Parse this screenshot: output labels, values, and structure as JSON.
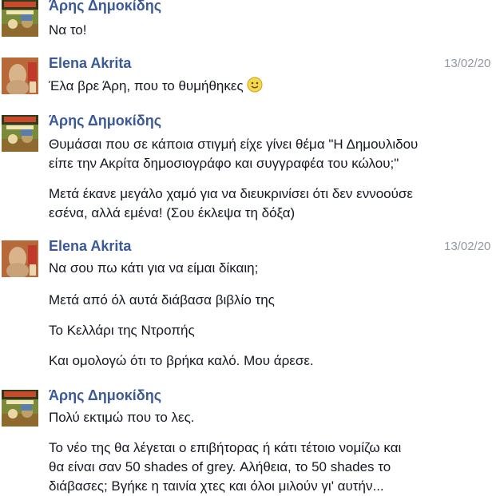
{
  "conversation": {
    "groups": [
      {
        "sender": "Άρης Δημοκίδης",
        "date": "",
        "messages": [
          "Να το!"
        ]
      },
      {
        "sender": "Elena Akrita",
        "date": "13/02/20",
        "messages": [
          "Έλα βρε Άρη, που το θυμήθηκες"
        ]
      },
      {
        "sender": "Άρης Δημοκίδης",
        "date": "",
        "messages": [
          "Θυμάσαι που σε κάποια στιγμή είχε γίνει θέμα \"Η Δημουλιδου",
          "είπε την Ακρίτα δημοσιογράφο και συγγραφέα του κώλου;\"",
          "Μετά έκανε μεγάλο χαμό για να διευκρινίσει ότι δεν εννοούσε",
          "εσένα, αλλά εμένα! (Σου έκλεψα τη δόξα)"
        ]
      },
      {
        "sender": "Elena Akrita",
        "date": "13/02/20",
        "messages": [
          "Να σου πω κάτι για να είμαι δίκαιη;",
          "Μετά από όλ αυτά διάβασα βιβλίο της",
          "Το Κελλάρι της Ντροπής",
          "Και ομολογώ ότι το βρήκα καλό. Μου άρεσε."
        ]
      },
      {
        "sender": "Άρης Δημοκίδης",
        "date": "",
        "messages": [
          "Πολύ εκτιμώ που το λες.",
          "Το νέο της θα λέγεται ο επιβήτορας ή κάτι τέτοιο νομίζω και",
          "θα είναι σαν 50 shades of grey. Αλήθεια, το 50 shades το",
          "διάβασες; Βγήκε η ταινία χτες και όλοι μιλούν γι' αυτήν..."
        ]
      }
    ],
    "emoji": "smiley-emoji-icon",
    "colors": {
      "sender": "#3b5998",
      "text": "#141823",
      "date": "#9197a3"
    }
  }
}
